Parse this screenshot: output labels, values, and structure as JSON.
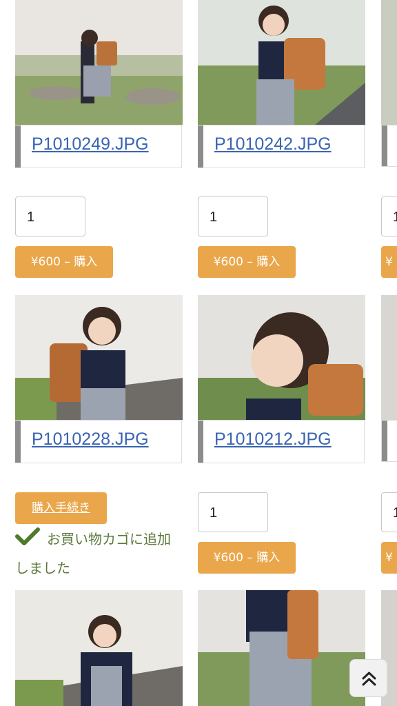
{
  "products": [
    {
      "filename": "P1010249.JPG",
      "quantity": "1",
      "buy_label": "¥600 – 購入"
    },
    {
      "filename": "P1010242.JPG",
      "quantity": "1",
      "buy_label": "¥600 – 購入"
    },
    {
      "filename": "P1010228.JPG",
      "checkout_label": "購入手続き",
      "added_message": "お買い物カゴに追加しました"
    },
    {
      "filename": "P1010212.JPG",
      "quantity": "1",
      "buy_label": "¥600 – 購入"
    }
  ],
  "peek_column": {
    "quantity": "1",
    "buy_label": "¥"
  },
  "colors": {
    "button": "#eaa64a",
    "link": "#3a64b3",
    "added_text": "#5d7a3a"
  },
  "icons": {
    "scroll_top": "double-chevron-up-icon",
    "added": "checkmark-icon"
  }
}
